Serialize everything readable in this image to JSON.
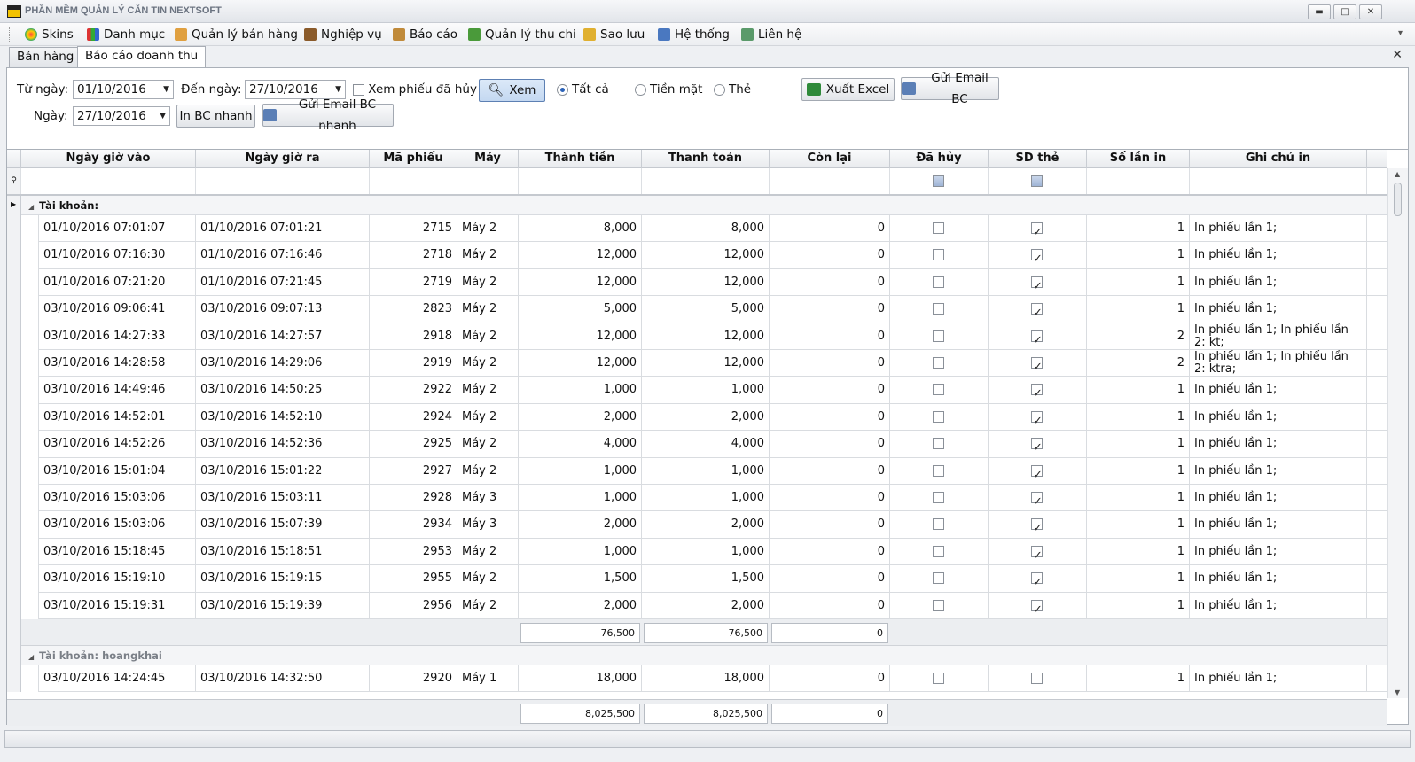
{
  "window": {
    "title": "PHẦN MỀM QUẢN LÝ CĂN TIN NEXTSOFT",
    "min": "▬",
    "max": "□",
    "close": "✕"
  },
  "menu": [
    {
      "label": "Skins",
      "icon": "skins-icon"
    },
    {
      "label": "Danh mục",
      "icon": "grid-icon"
    },
    {
      "label": "Quản lý bán hàng",
      "icon": "sales-icon"
    },
    {
      "label": "Nghiệp vụ",
      "icon": "briefcase-icon"
    },
    {
      "label": "Báo cáo",
      "icon": "clipboard-icon"
    },
    {
      "label": "Quản lý thu chi",
      "icon": "money-icon"
    },
    {
      "label": "Sao lưu",
      "icon": "database-icon"
    },
    {
      "label": "Hệ thống",
      "icon": "gears-icon"
    },
    {
      "label": "Liên hệ",
      "icon": "user-icon"
    }
  ],
  "tabs": [
    {
      "label": "Bán hàng"
    },
    {
      "label": "Báo cáo doanh thu",
      "active": true
    }
  ],
  "filters": {
    "from_label": "Từ ngày:",
    "from_value": "01/10/2016",
    "to_label": "Đến ngày:",
    "to_value": "27/10/2016",
    "show_cancelled_label": "Xem phiếu đã hủy",
    "view_button": "Xem",
    "radio_all": "Tất cả",
    "radio_cash": "Tiền mặt",
    "radio_card": "Thẻ",
    "export_excel": "Xuất Excel",
    "send_email": "Gửi Email BC",
    "date_label": "Ngày:",
    "date_value": "27/10/2016",
    "print_quick": "In BC nhanh",
    "send_email_quick": "Gửi Email BC nhanh"
  },
  "grid": {
    "columns": [
      "Ngày giờ vào",
      "Ngày giờ ra",
      "Mã phiếu",
      "Máy",
      "Thành tiền",
      "Thanh toán",
      "Còn lại",
      "Đã hủy",
      "SD thẻ",
      "Số lần in",
      "Ghi chú in"
    ],
    "group1_label": "Tài khoản:",
    "group1_rows": [
      [
        "01/10/2016 07:01:07",
        "01/10/2016 07:01:21",
        "2715",
        "Máy 2",
        "8,000",
        "8,000",
        "0",
        false,
        true,
        "1",
        "In phiếu lần 1;"
      ],
      [
        "01/10/2016 07:16:30",
        "01/10/2016 07:16:46",
        "2718",
        "Máy 2",
        "12,000",
        "12,000",
        "0",
        false,
        true,
        "1",
        "In phiếu lần 1;"
      ],
      [
        "01/10/2016 07:21:20",
        "01/10/2016 07:21:45",
        "2719",
        "Máy 2",
        "12,000",
        "12,000",
        "0",
        false,
        true,
        "1",
        "In phiếu lần 1;"
      ],
      [
        "03/10/2016 09:06:41",
        "03/10/2016 09:07:13",
        "2823",
        "Máy 2",
        "5,000",
        "5,000",
        "0",
        false,
        true,
        "1",
        "In phiếu lần 1;"
      ],
      [
        "03/10/2016 14:27:33",
        "03/10/2016 14:27:57",
        "2918",
        "Máy 2",
        "12,000",
        "12,000",
        "0",
        false,
        true,
        "2",
        "In phiếu lần 1; In phiếu lần 2: kt;"
      ],
      [
        "03/10/2016 14:28:58",
        "03/10/2016 14:29:06",
        "2919",
        "Máy 2",
        "12,000",
        "12,000",
        "0",
        false,
        true,
        "2",
        "In phiếu lần 1; In phiếu lần 2: ktra;"
      ],
      [
        "03/10/2016 14:49:46",
        "03/10/2016 14:50:25",
        "2922",
        "Máy 2",
        "1,000",
        "1,000",
        "0",
        false,
        true,
        "1",
        "In phiếu lần 1;"
      ],
      [
        "03/10/2016 14:52:01",
        "03/10/2016 14:52:10",
        "2924",
        "Máy 2",
        "2,000",
        "2,000",
        "0",
        false,
        true,
        "1",
        "In phiếu lần 1;"
      ],
      [
        "03/10/2016 14:52:26",
        "03/10/2016 14:52:36",
        "2925",
        "Máy 2",
        "4,000",
        "4,000",
        "0",
        false,
        true,
        "1",
        "In phiếu lần 1;"
      ],
      [
        "03/10/2016 15:01:04",
        "03/10/2016 15:01:22",
        "2927",
        "Máy 2",
        "1,000",
        "1,000",
        "0",
        false,
        true,
        "1",
        "In phiếu lần 1;"
      ],
      [
        "03/10/2016 15:03:06",
        "03/10/2016 15:03:11",
        "2928",
        "Máy 3",
        "1,000",
        "1,000",
        "0",
        false,
        true,
        "1",
        "In phiếu lần 1;"
      ],
      [
        "03/10/2016 15:03:06",
        "03/10/2016 15:07:39",
        "2934",
        "Máy 3",
        "2,000",
        "2,000",
        "0",
        false,
        true,
        "1",
        "In phiếu lần 1;"
      ],
      [
        "03/10/2016 15:18:45",
        "03/10/2016 15:18:51",
        "2953",
        "Máy 2",
        "1,000",
        "1,000",
        "0",
        false,
        true,
        "1",
        "In phiếu lần 1;"
      ],
      [
        "03/10/2016 15:19:10",
        "03/10/2016 15:19:15",
        "2955",
        "Máy 2",
        "1,500",
        "1,500",
        "0",
        false,
        true,
        "1",
        "In phiếu lần 1;"
      ],
      [
        "03/10/2016 15:19:31",
        "03/10/2016 15:19:39",
        "2956",
        "Máy 2",
        "2,000",
        "2,000",
        "0",
        false,
        true,
        "1",
        "In phiếu lần 1;"
      ]
    ],
    "group1_totals": [
      "76,500",
      "76,500",
      "0"
    ],
    "group2_label": "Tài khoản: hoangkhai",
    "group2_rows": [
      [
        "03/10/2016 14:24:45",
        "03/10/2016 14:32:50",
        "2920",
        "Máy 1",
        "18,000",
        "18,000",
        "0",
        false,
        false,
        "1",
        "In phiếu lần 1;"
      ]
    ],
    "grand_totals": [
      "8,025,500",
      "8,025,500",
      "0"
    ]
  }
}
